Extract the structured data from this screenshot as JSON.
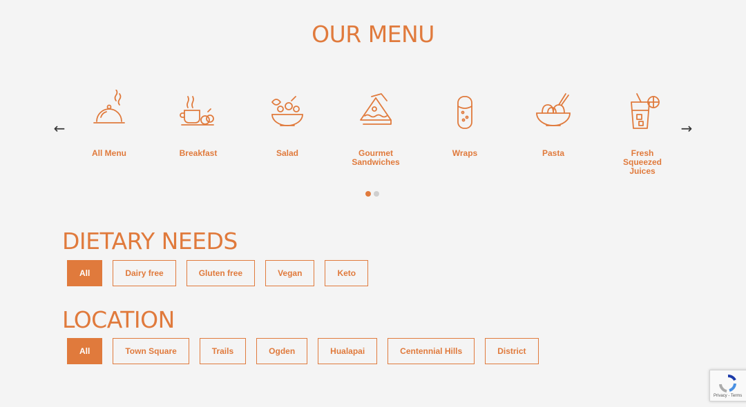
{
  "menu": {
    "title": "OUR MENU",
    "categories": [
      {
        "label": "All Menu",
        "icon": "cloche-icon"
      },
      {
        "label": "Breakfast",
        "icon": "breakfast-icon"
      },
      {
        "label": "Salad",
        "icon": "salad-bowl-icon"
      },
      {
        "label": "Gourmet\nSandwiches",
        "icon": "sandwich-icon"
      },
      {
        "label": "Wraps",
        "icon": "wrap-icon"
      },
      {
        "label": "Pasta",
        "icon": "pasta-bowl-icon"
      },
      {
        "label": "Fresh\nSqueezed\nJuices",
        "icon": "juice-glass-icon"
      }
    ],
    "prev_icon": "arrow-left-icon",
    "next_icon": "arrow-right-icon",
    "pages": 2,
    "active_page": 1
  },
  "dietary": {
    "title": "DIETARY NEEDS",
    "filters": [
      "All",
      "Dairy free",
      "Gluten free",
      "Vegan",
      "Keto"
    ],
    "active": "All"
  },
  "location": {
    "title": "LOCATION",
    "filters": [
      "All",
      "Town Square",
      "Trails",
      "Ogden",
      "Hualapai",
      "Centennial Hills",
      "District"
    ],
    "active": "All"
  },
  "recaptcha": {
    "text": "Privacy - Terms"
  },
  "colors": {
    "accent": "#e07a3c",
    "background": "#f4f4f4"
  }
}
